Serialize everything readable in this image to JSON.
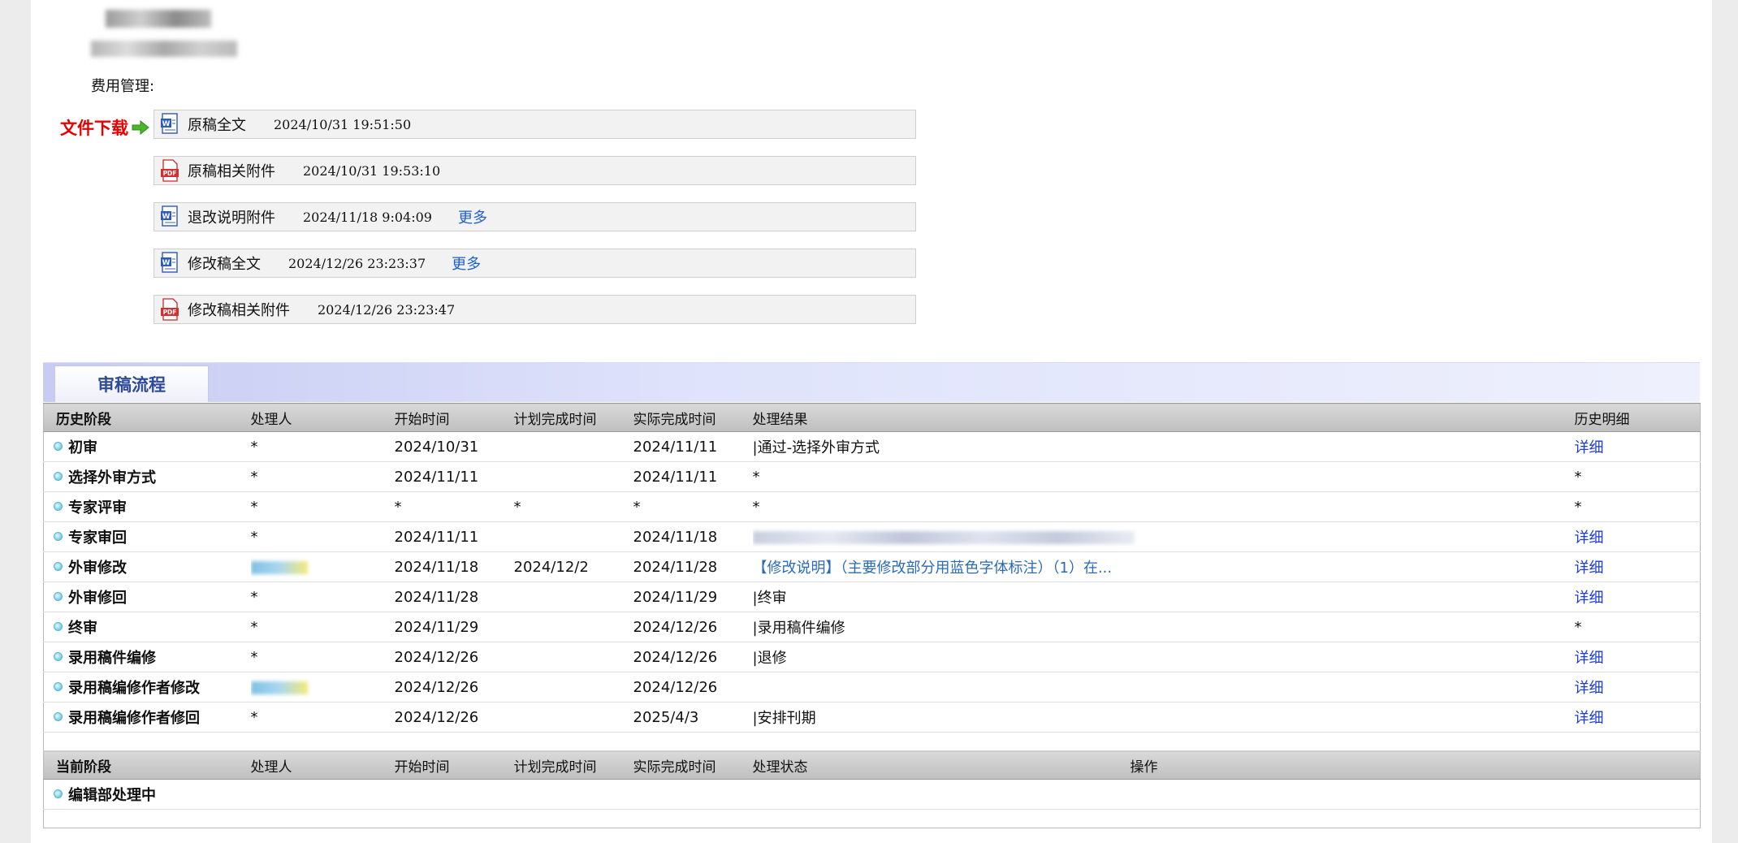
{
  "fee_label": "费用管理:",
  "download_label": "文件下载",
  "files": [
    {
      "icon": "word-icon",
      "name": "原稿全文",
      "time": "2024/10/31 19:51:50",
      "more": ""
    },
    {
      "icon": "pdf-icon",
      "name": "原稿相关附件",
      "time": "2024/10/31 19:53:10",
      "more": ""
    },
    {
      "icon": "word-icon",
      "name": "退改说明附件",
      "time": "2024/11/18 9:04:09",
      "more": "更多"
    },
    {
      "icon": "word-icon",
      "name": "修改稿全文",
      "time": "2024/12/26 23:23:37",
      "more": "更多"
    },
    {
      "icon": "pdf-icon",
      "name": "修改稿相关附件",
      "time": "2024/12/26 23:23:47",
      "more": ""
    }
  ],
  "process_tab": "审稿流程",
  "history_headers": [
    "历史阶段",
    "处理人",
    "开始时间",
    "计划完成时间",
    "实际完成时间",
    "处理结果",
    "历史明细"
  ],
  "history_rows": [
    {
      "stage": "初审",
      "handler": "*",
      "start": "2024/10/31",
      "plan": "",
      "actual": "2024/11/11",
      "result": "|通过-选择外审方式",
      "detail": "详细"
    },
    {
      "stage": "选择外审方式",
      "handler": "*",
      "start": "2024/11/11",
      "plan": "",
      "actual": "2024/11/11",
      "result": "*",
      "detail": "*"
    },
    {
      "stage": "专家评审",
      "handler": "*",
      "start": "*",
      "plan": "*",
      "actual": "*",
      "result": "*",
      "detail": "*"
    },
    {
      "stage": "专家审回",
      "handler": "*",
      "start": "2024/11/11",
      "plan": "",
      "actual": "2024/11/18",
      "result": "",
      "detail": "详细"
    },
    {
      "stage": "外审修改",
      "handler": "",
      "start": "2024/11/18",
      "plan": "2024/12/2",
      "actual": "2024/11/28",
      "result": "【修改说明】（主要修改部分用蓝色字体标注）（1）在...",
      "detail": "详细"
    },
    {
      "stage": "外审修回",
      "handler": "*",
      "start": "2024/11/28",
      "plan": "",
      "actual": "2024/11/29",
      "result": "|终审",
      "detail": "详细"
    },
    {
      "stage": "终审",
      "handler": "*",
      "start": "2024/11/29",
      "plan": "",
      "actual": "2024/12/26",
      "result": "|录用稿件编修",
      "detail": "*"
    },
    {
      "stage": "录用稿件编修",
      "handler": "*",
      "start": "2024/12/26",
      "plan": "",
      "actual": "2024/12/26",
      "result": "|退修",
      "detail": "详细"
    },
    {
      "stage": "录用稿编修作者修改",
      "handler": "",
      "start": "2024/12/26",
      "plan": "",
      "actual": "2024/12/26",
      "result": "",
      "detail": "详细"
    },
    {
      "stage": "录用稿编修作者修回",
      "handler": "*",
      "start": "2024/12/26",
      "plan": "",
      "actual": "2025/4/3",
      "result": "|安排刊期",
      "detail": "详细"
    }
  ],
  "current_headers": [
    "当前阶段",
    "处理人",
    "开始时间",
    "计划完成时间",
    "实际完成时间",
    "处理状态",
    "操作"
  ],
  "current_rows": [
    {
      "stage": "编辑部处理中"
    }
  ],
  "colors": {
    "link": "#1a3bd6",
    "download_label": "#e60000",
    "tab_text": "#2f4a9c"
  }
}
